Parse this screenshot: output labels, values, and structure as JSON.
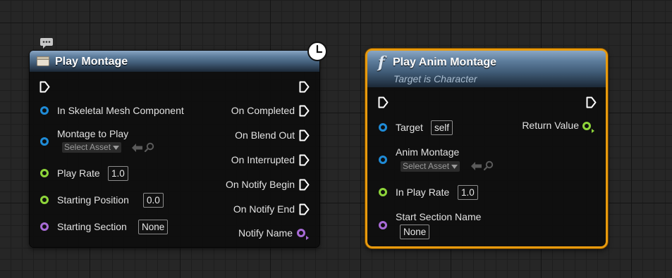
{
  "colors": {
    "exec_pin": "#ffffff",
    "object_pin": "#1f8bd6",
    "float_pin": "#8ed53a",
    "name_pin": "#a86bd6",
    "selection_outline": "#e89a0d",
    "header_blue": "#4a6d8c"
  },
  "play_montage": {
    "title": "Play Montage",
    "inputs": {
      "skeletal_mesh": "In Skeletal Mesh Component",
      "montage": "Montage to Play",
      "montage_asset": "Select Asset",
      "play_rate": "Play Rate",
      "play_rate_value": "1.0",
      "starting_position": "Starting Position",
      "starting_position_value": "0.0",
      "starting_section": "Starting Section",
      "starting_section_value": "None"
    },
    "outputs": {
      "on_completed": "On Completed",
      "on_blend_out": "On Blend Out",
      "on_interrupted": "On Interrupted",
      "on_notify_begin": "On Notify Begin",
      "on_notify_end": "On Notify End",
      "notify_name": "Notify Name"
    }
  },
  "play_anim_montage": {
    "title": "Play Anim Montage",
    "subtitle": "Target is Character",
    "function_glyph": "f",
    "inputs": {
      "target": "Target",
      "target_value": "self",
      "anim_montage": "Anim Montage",
      "anim_montage_asset": "Select Asset",
      "in_play_rate": "In Play Rate",
      "in_play_rate_value": "1.0",
      "start_section": "Start Section Name",
      "start_section_value": "None"
    },
    "outputs": {
      "return_value": "Return Value"
    }
  }
}
